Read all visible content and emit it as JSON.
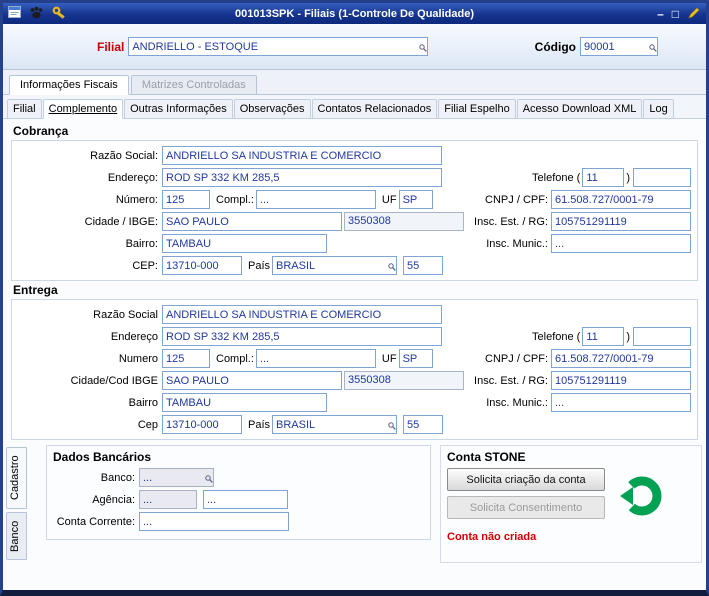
{
  "window": {
    "title": "001013SPK - Filiais (1-Controle De Qualidade)",
    "minimize": "–",
    "maximize": "□"
  },
  "colors": {
    "titlebar_blue": "#16338f",
    "filial_label_red": "#cc0000",
    "field_value_blue": "#2038a0",
    "stone_green": "#00a152",
    "status_red": "#d30000"
  },
  "header": {
    "filial_label": "Filial",
    "filial_value": "ANDRIELLO - ESTOQUE",
    "codigo_label": "Código",
    "codigo_value": "90001"
  },
  "outer_tabs": {
    "informacoes_fiscais": "Informações Fiscais",
    "matrizes_controladas": "Matrizes Controladas"
  },
  "tabs": {
    "filial": "Filial",
    "complemento": "Complemento",
    "outras_informacoes": "Outras Informações",
    "observacoes": "Observações",
    "contatos_relacionados": "Contatos Relacionados",
    "filial_espelho": "Filial Espelho",
    "acesso_download_xml": "Acesso Download XML",
    "log": "Log"
  },
  "cobranca": {
    "title": "Cobrança",
    "labels": {
      "razao_social": "Razão Social:",
      "endereco": "Endereço:",
      "numero": "Número:",
      "compl": "Compl.:",
      "uf": "UF",
      "cidade": "Cidade / IBGE:",
      "bairro": "Bairro:",
      "cep": "CEP:",
      "pais": "País",
      "telefone": "Telefone (",
      "telefone_fecha": ")",
      "cnpj": "CNPJ / CPF:",
      "insc_est": "Insc. Est. / RG:",
      "insc_mun": "Insc. Munic.:"
    },
    "values": {
      "razao_social": "ANDRIELLO SA INDUSTRIA E COMERCIO",
      "endereco": "ROD SP 332 KM 285,5",
      "numero": "125",
      "compl": "...",
      "uf": "SP",
      "cidade": "SAO PAULO",
      "ibge": "3550308",
      "bairro": "TAMBAU",
      "cep": "13710-000",
      "pais": "BRASIL",
      "ddi": "55",
      "ddd": "11",
      "telefone": "",
      "cnpj": "61.508.727/0001-79",
      "insc_est": "105751291119",
      "insc_mun": "..."
    }
  },
  "entrega": {
    "title": "Entrega",
    "labels": {
      "razao_social": "Razão Social",
      "endereco": "Endereço",
      "numero": "Numero",
      "compl": "Compl.:",
      "uf": "UF",
      "cidade": "Cidade/Cod IBGE",
      "bairro": "Bairro",
      "cep": "Cep",
      "pais": "País",
      "telefone": "Telefone (",
      "telefone_fecha": ")",
      "cnpj": "CNPJ / CPF:",
      "insc_est": "Insc. Est. / RG:",
      "insc_mun": "Insc. Munic.:"
    },
    "values": {
      "razao_social": "ANDRIELLO SA INDUSTRIA E COMERCIO",
      "endereco": "ROD SP 332 KM 285,5",
      "numero": "125",
      "compl": "...",
      "uf": "SP",
      "cidade": "SAO PAULO",
      "ibge": "3550308",
      "bairro": "TAMBAU",
      "cep": "13710-000",
      "pais": "BRASIL",
      "ddi": "55",
      "ddd": "11",
      "telefone": "",
      "cnpj": "61.508.727/0001-79",
      "insc_est": "105751291119",
      "insc_mun": "..."
    }
  },
  "bottom": {
    "side_tabs": {
      "cadastro": "Cadastro",
      "banco": "Banco"
    },
    "dados_bancarios": {
      "title": "Dados Bancários",
      "banco_label": "Banco:",
      "banco": "...",
      "agencia_label": "Agência:",
      "agencia": "...",
      "agencia_conta": "...",
      "conta_corrente_label": "Conta Corrente:",
      "conta_corrente": "..."
    },
    "conta_stone": {
      "title": "Conta STONE",
      "solicita_criacao": "Solicita criação da conta",
      "solicita_consentimento": "Solicita Consentimento",
      "status": "Conta não criada"
    }
  }
}
